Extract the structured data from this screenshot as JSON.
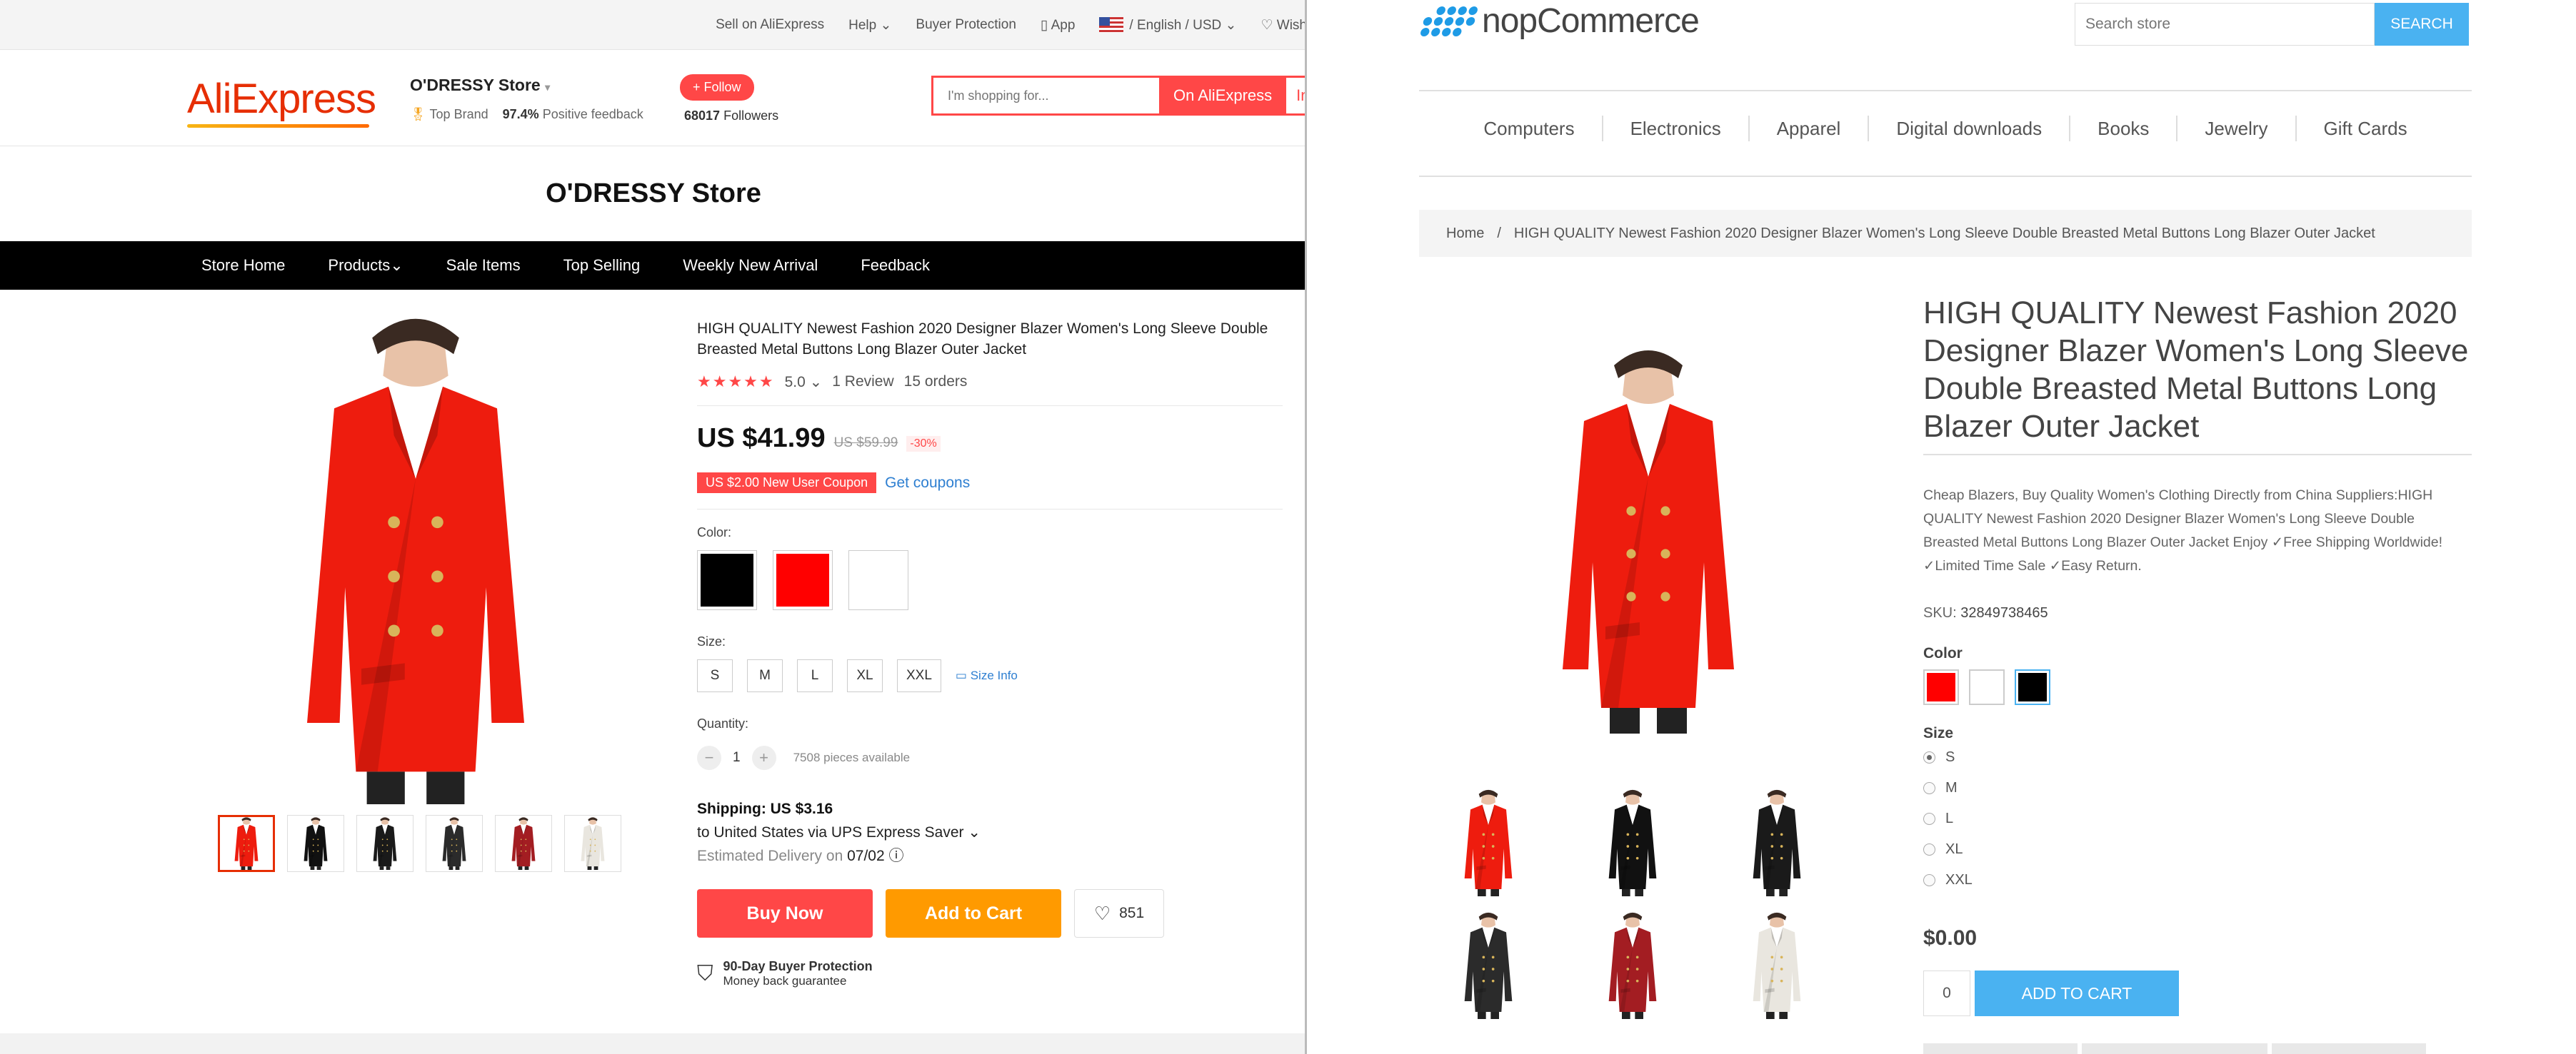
{
  "aliexpress": {
    "top_links": [
      "Sell on AliExpress",
      "Help",
      "Buyer Protection",
      "App",
      "/ English / USD",
      "Wish"
    ],
    "logo": "AliExpress",
    "store": {
      "name": "O'DRESSY Store",
      "badge": "Top Brand",
      "feedback_pct": "97.4%",
      "feedback_label": "Positive feedback",
      "follow": "+ Follow",
      "followers_count": "68017",
      "followers_label": "Followers"
    },
    "search": {
      "placeholder": "I'm shopping for...",
      "btn1": "On AliExpress",
      "btn2": "In t"
    },
    "store_title": "O'DRESSY Store",
    "nav": [
      "Store Home",
      "Products",
      "Sale Items",
      "Top Selling",
      "Weekly New Arrival",
      "Feedback"
    ],
    "product": {
      "title": "HIGH QUALITY Newest Fashion 2020 Designer Blazer Women's Long Sleeve Double Breasted Metal Buttons Long Blazer Outer Jacket",
      "rating": "5.0",
      "reviews": "1 Review",
      "orders": "15 orders",
      "price": "US $41.99",
      "old_price": "US $59.99",
      "discount": "-30%",
      "coupon": "US $2.00 New User Coupon",
      "get_coupons": "Get coupons",
      "color_label": "Color:",
      "colors": [
        "#000000",
        "#ff0000",
        "#ffffff"
      ],
      "size_label": "Size:",
      "sizes": [
        "S",
        "M",
        "L",
        "XL",
        "XXL"
      ],
      "size_info": "Size Info",
      "qty_label": "Quantity:",
      "qty": "1",
      "available": "7508 pieces available",
      "shipping": "Shipping: US $3.16",
      "ship_to": "to United States via UPS Express Saver",
      "delivery_label": "Estimated Delivery on",
      "delivery_date": "07/02",
      "buy_now": "Buy Now",
      "add_to_cart": "Add to Cart",
      "wish_count": "851",
      "protection_title": "90-Day Buyer Protection",
      "protection_sub": "Money back guarantee"
    }
  },
  "nop": {
    "logo": "nopCommerce",
    "search": {
      "placeholder": "Search store",
      "button": "SEARCH"
    },
    "menu": [
      "Computers",
      "Electronics",
      "Apparel",
      "Digital downloads",
      "Books",
      "Jewelry",
      "Gift Cards"
    ],
    "breadcrumb": {
      "home": "Home",
      "sep": "/",
      "current": "HIGH QUALITY Newest Fashion 2020 Designer Blazer Women's Long Sleeve Double Breasted Metal Buttons Long Blazer Outer Jacket"
    },
    "product_name": "HIGH QUALITY Newest Fashion 2020 Designer Blazer Women's Long Sleeve Double Breasted Metal Buttons Long Blazer Outer Jacket",
    "description": "Cheap Blazers, Buy Quality Women's Clothing Directly from China Suppliers:HIGH QUALITY Newest Fashion 2020 Designer Blazer Women's Long Sleeve Double Breasted Metal Buttons Long Blazer Outer Jacket Enjoy ✓Free Shipping Worldwide! ✓Limited Time Sale ✓Easy Return.",
    "sku_label": "SKU:",
    "sku": "32849738465",
    "color_label": "Color",
    "colors": [
      "#ff0000",
      "#ffffff",
      "#000000"
    ],
    "size_label": "Size",
    "sizes": [
      "S",
      "M",
      "L",
      "XL",
      "XXL"
    ],
    "price": "$0.00",
    "qty": "0",
    "add_to_cart": "ADD TO CART"
  }
}
